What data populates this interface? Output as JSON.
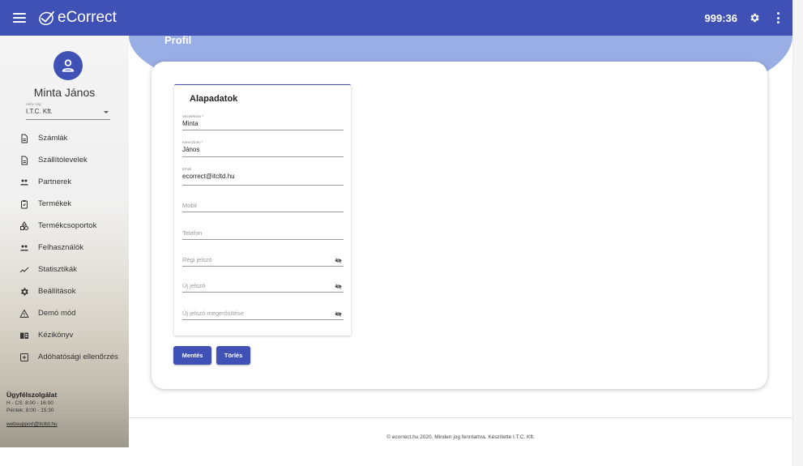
{
  "header": {
    "app_title": "eCorrect",
    "timer": "999:36",
    "menu_icon": "hamburger-icon",
    "settings_icon": "gear-icon",
    "more_icon": "more-vert-icon"
  },
  "sidebar": {
    "user_name": "Minta János",
    "company_label": "Aktív cég",
    "company_value": "I.T.C. Kft.",
    "items": [
      {
        "label": "Számlák",
        "icon": "document-icon"
      },
      {
        "label": "Szállítólevelek",
        "icon": "document-icon"
      },
      {
        "label": "Partnerek",
        "icon": "people-icon"
      },
      {
        "label": "Termékek",
        "icon": "clipboard-icon"
      },
      {
        "label": "Termékcsoportok",
        "icon": "category-icon"
      },
      {
        "label": "Felhasználók",
        "icon": "people-icon"
      },
      {
        "label": "Statisztikák",
        "icon": "trend-icon"
      },
      {
        "label": "Beállítások",
        "icon": "gear-icon"
      },
      {
        "label": "Demó mód",
        "icon": "warning-icon"
      },
      {
        "label": "Kézikönyv",
        "icon": "book-icon"
      },
      {
        "label": "Adóhatósági ellenőrzés",
        "icon": "plus-box-icon"
      }
    ],
    "support": {
      "title": "Ügyfélszolgálat",
      "hours1": "H - CS: 8:00 - 16:00",
      "hours2": "Péntek: 8:00 - 15:30",
      "email": "websupport@itcltd.hu"
    }
  },
  "main": {
    "page_title": "Profil",
    "panel_title": "Alapadatok",
    "fields": {
      "lastname": {
        "label": "Vezetéknév *",
        "value": "Minta"
      },
      "firstname": {
        "label": "Keresztnév *",
        "value": "János"
      },
      "email": {
        "label": "Email",
        "value": "ecorrect@itcltd.hu"
      },
      "mobile": {
        "placeholder": "Mobil"
      },
      "phone": {
        "placeholder": "Telefon"
      },
      "old_password": {
        "placeholder": "Régi jelszó"
      },
      "new_password": {
        "placeholder": "Új jelszó"
      },
      "confirm_password": {
        "placeholder": "Új jelszó megerősítése"
      }
    },
    "save_label": "Mentés",
    "delete_label": "Törlés"
  },
  "footer": {
    "text": "© ecorrect.hu 2020. Minden jog fenntartva. Készítette I.T.C. Kft."
  },
  "colors": {
    "primary": "#3f51b5",
    "banner": "#9aaee6"
  }
}
